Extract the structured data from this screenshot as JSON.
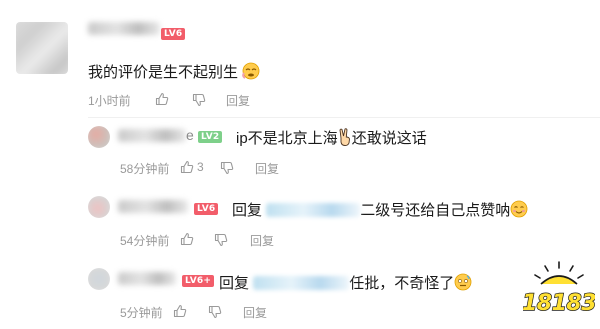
{
  "comments": [
    {
      "badge": "LV6",
      "text": "我的评价是生不起别生",
      "time": "1小时前",
      "reply_label": "回复"
    }
  ],
  "replies": [
    {
      "name_tail": "e",
      "badge": "LV2",
      "text": "ip不是北京上海",
      "text_after_emoji": "还敢说这话",
      "time": "58分钟前",
      "dislike_count": "3",
      "reply_label": "回复"
    },
    {
      "badge": "LV6",
      "prefix": "回复",
      "text": "二级号还给自己点赞呐",
      "time": "54分钟前",
      "reply_label": "回复"
    },
    {
      "badge": "LV6+",
      "prefix": "回复",
      "text": "任批，不奇怪了",
      "time": "5分钟前",
      "reply_label": "回复"
    }
  ],
  "watermark": {
    "text": "18183"
  },
  "colors": {
    "badge_red": "#f25d6a",
    "badge_green": "#7ed08a",
    "meta_gray": "#9a9a9a",
    "watermark_fill": "#ffe033",
    "watermark_stroke": "#1a1a1a"
  },
  "icons": [
    "thumbs-up-icon",
    "thumbs-down-icon",
    "emoji-icon"
  ]
}
